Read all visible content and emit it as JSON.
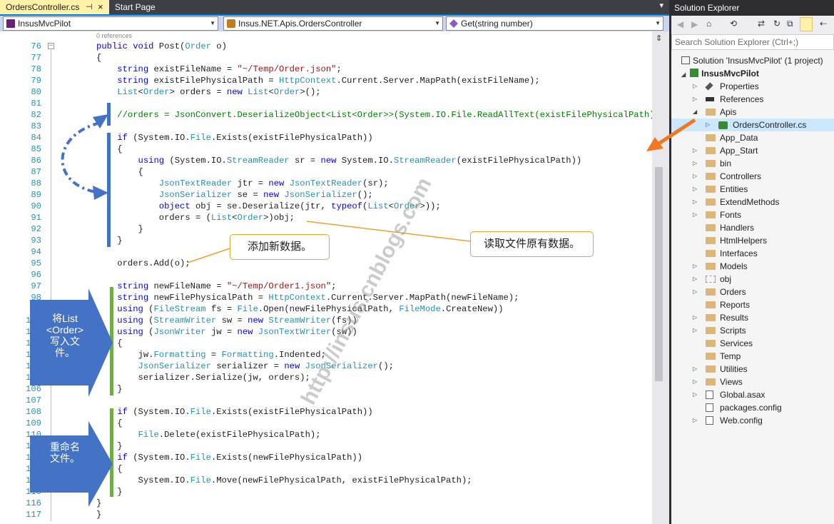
{
  "tabs": {
    "active": "OrdersController.cs",
    "active_pin": "⊣",
    "active_close": "×",
    "start": "Start Page",
    "overflow": "▾"
  },
  "nav": {
    "project": "InsusMvcPilot",
    "class": "Insus.NET.Apis.OrdersController",
    "method": "Get(string number)"
  },
  "codelens": "0 references",
  "lines": [
    {
      "n": "76",
      "t": "public void Post(Order o)"
    },
    {
      "n": "77",
      "t": "{"
    },
    {
      "n": "78",
      "t": "    string existFileName = \"~/Temp/Order.json\";"
    },
    {
      "n": "79",
      "t": "    string existFilePhysicalPath = HttpContext.Current.Server.MapPath(existFileName);"
    },
    {
      "n": "80",
      "t": "    List<Order> orders = new List<Order>();"
    },
    {
      "n": "81",
      "t": ""
    },
    {
      "n": "82",
      "t": "    //orders = JsonConvert.DeserializeObject<List<Order>>(System.IO.File.ReadAllText(existFilePhysicalPath));"
    },
    {
      "n": "83",
      "t": ""
    },
    {
      "n": "84",
      "t": "    if (System.IO.File.Exists(existFilePhysicalPath))"
    },
    {
      "n": "85",
      "t": "    {"
    },
    {
      "n": "86",
      "t": "        using (System.IO.StreamReader sr = new System.IO.StreamReader(existFilePhysicalPath))"
    },
    {
      "n": "87",
      "t": "        {"
    },
    {
      "n": "88",
      "t": "            JsonTextReader jtr = new JsonTextReader(sr);"
    },
    {
      "n": "89",
      "t": "            JsonSerializer se = new JsonSerializer();"
    },
    {
      "n": "90",
      "t": "            object obj = se.Deserialize(jtr, typeof(List<Order>));"
    },
    {
      "n": "91",
      "t": "            orders = (List<Order>)obj;"
    },
    {
      "n": "92",
      "t": "        }"
    },
    {
      "n": "93",
      "t": "    }"
    },
    {
      "n": "94",
      "t": ""
    },
    {
      "n": "95",
      "t": "    orders.Add(o);"
    },
    {
      "n": "96",
      "t": ""
    },
    {
      "n": "97",
      "t": "    string newFileName = \"~/Temp/Order1.json\";"
    },
    {
      "n": "98",
      "t": "    string newFilePhysicalPath = HttpContext.Current.Server.MapPath(newFileName);"
    },
    {
      "n": "99",
      "t": "    using (FileStream fs = File.Open(newFilePhysicalPath, FileMode.CreateNew))"
    },
    {
      "n": "100",
      "t": "    using (StreamWriter sw = new StreamWriter(fs))"
    },
    {
      "n": "101",
      "t": "    using (JsonWriter jw = new JsonTextWriter(sw))"
    },
    {
      "n": "102",
      "t": "    {"
    },
    {
      "n": "103",
      "t": "        jw.Formatting = Formatting.Indented;"
    },
    {
      "n": "104",
      "t": "        JsonSerializer serializer = new JsonSerializer();"
    },
    {
      "n": "105",
      "t": "        serializer.Serialize(jw, orders);"
    },
    {
      "n": "106",
      "t": "    }"
    },
    {
      "n": "107",
      "t": ""
    },
    {
      "n": "108",
      "t": "    if (System.IO.File.Exists(existFilePhysicalPath))"
    },
    {
      "n": "109",
      "t": "    {"
    },
    {
      "n": "110",
      "t": "        File.Delete(existFilePhysicalPath);"
    },
    {
      "n": "111",
      "t": "    }"
    },
    {
      "n": "112",
      "t": "    if (System.IO.File.Exists(newFilePhysicalPath))"
    },
    {
      "n": "113",
      "t": "    {"
    },
    {
      "n": "114",
      "t": "        System.IO.File.Move(newFilePhysicalPath, existFilePhysicalPath);"
    },
    {
      "n": "115",
      "t": "    }"
    },
    {
      "n": "116",
      "t": "}"
    },
    {
      "n": "117",
      "t": "}"
    }
  ],
  "annotations": {
    "add_new": "添加新数据。",
    "read_original": "读取文件原有数据。",
    "write_list": "将List\n<Order>\n写入文\n件。",
    "rename": "重命名\n文件。",
    "watermark": "http://insus.cnblogs.com"
  },
  "solution_explorer": {
    "title": "Solution Explorer",
    "search_placeholder": "Search Solution Explorer (Ctrl+;)",
    "solution": "Solution 'InsusMvcPilot' (1 project)",
    "project": "InsusMvcPilot",
    "items": [
      {
        "label": "Properties",
        "icon": "wrench-icon",
        "exp": "▷",
        "lvl": 2
      },
      {
        "label": "References",
        "icon": "references-icon",
        "exp": "▷",
        "lvl": 2
      },
      {
        "label": "Apis",
        "icon": "folder-open-icon",
        "exp": "◢",
        "lvl": 2
      },
      {
        "label": "OrdersController.cs",
        "icon": "csharp-file-icon",
        "exp": "▷",
        "lvl": 3,
        "selected": true
      },
      {
        "label": "App_Data",
        "icon": "folder-icon",
        "exp": "",
        "lvl": 2
      },
      {
        "label": "App_Start",
        "icon": "folder-icon",
        "exp": "▷",
        "lvl": 2
      },
      {
        "label": "bin",
        "icon": "folder-icon",
        "exp": "▷",
        "lvl": 2
      },
      {
        "label": "Controllers",
        "icon": "folder-icon",
        "exp": "▷",
        "lvl": 2
      },
      {
        "label": "Entities",
        "icon": "folder-icon",
        "exp": "▷",
        "lvl": 2
      },
      {
        "label": "ExtendMethods",
        "icon": "folder-icon",
        "exp": "▷",
        "lvl": 2
      },
      {
        "label": "Fonts",
        "icon": "folder-icon",
        "exp": "▷",
        "lvl": 2
      },
      {
        "label": "Handlers",
        "icon": "folder-icon",
        "exp": "",
        "lvl": 2
      },
      {
        "label": "HtmlHelpers",
        "icon": "folder-icon",
        "exp": "",
        "lvl": 2
      },
      {
        "label": "Interfaces",
        "icon": "folder-icon",
        "exp": "",
        "lvl": 2
      },
      {
        "label": "Models",
        "icon": "folder-icon",
        "exp": "▷",
        "lvl": 2
      },
      {
        "label": "obj",
        "icon": "folder-dashed-icon",
        "exp": "▷",
        "lvl": 2
      },
      {
        "label": "Orders",
        "icon": "folder-icon",
        "exp": "▷",
        "lvl": 2
      },
      {
        "label": "Reports",
        "icon": "folder-icon",
        "exp": "",
        "lvl": 2
      },
      {
        "label": "Results",
        "icon": "folder-icon",
        "exp": "▷",
        "lvl": 2
      },
      {
        "label": "Scripts",
        "icon": "folder-icon",
        "exp": "▷",
        "lvl": 2
      },
      {
        "label": "Services",
        "icon": "folder-icon",
        "exp": "",
        "lvl": 2
      },
      {
        "label": "Temp",
        "icon": "folder-icon",
        "exp": "",
        "lvl": 2
      },
      {
        "label": "Utilities",
        "icon": "folder-icon",
        "exp": "▷",
        "lvl": 2
      },
      {
        "label": "Views",
        "icon": "folder-icon",
        "exp": "▷",
        "lvl": 2
      },
      {
        "label": "Global.asax",
        "icon": "globe-file-icon",
        "exp": "▷",
        "lvl": 2
      },
      {
        "label": "packages.config",
        "icon": "config-file-icon",
        "exp": "",
        "lvl": 2
      },
      {
        "label": "Web.config",
        "icon": "config-file-icon",
        "exp": "▷",
        "lvl": 2
      }
    ]
  },
  "colors": {
    "keyword": "#0000ff",
    "type": "#2b91af",
    "string": "#a31515",
    "comment": "#008000",
    "bar_blue": "#4472c4",
    "bar_green": "#70ad47",
    "accent": "#007acc",
    "callout_border": "#f0a030"
  }
}
